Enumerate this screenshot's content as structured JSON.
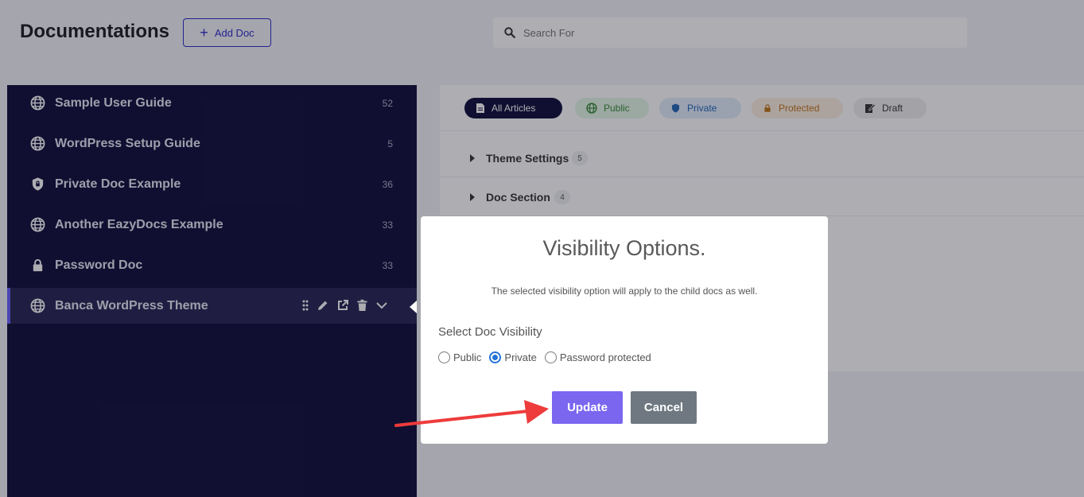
{
  "header": {
    "title": "Documentations",
    "add_doc_label": "Add Doc",
    "search_placeholder": "Search For"
  },
  "sidebar": {
    "items": [
      {
        "label": "Sample User Guide",
        "count": "52",
        "icon": "globe-icon"
      },
      {
        "label": "WordPress Setup Guide",
        "count": "5",
        "icon": "globe-icon"
      },
      {
        "label": "Private Doc Example",
        "count": "36",
        "icon": "shield-icon"
      },
      {
        "label": "Another EazyDocs Example",
        "count": "33",
        "icon": "globe-icon"
      },
      {
        "label": "Password Doc",
        "count": "33",
        "icon": "lock-icon"
      },
      {
        "label": "Banca WordPress Theme",
        "count": "",
        "icon": "globe-icon",
        "active": true
      }
    ]
  },
  "filters": {
    "all": "All Articles",
    "public": "Public",
    "private": "Private",
    "protected": "Protected",
    "draft": "Draft"
  },
  "sections": [
    {
      "label": "Theme Settings",
      "count": "5"
    },
    {
      "label": "Doc Section",
      "count": "4"
    }
  ],
  "modal": {
    "title": "Visibility Options.",
    "description": "The selected visibility option will apply to the child docs as well.",
    "select_label": "Select Doc Visibility",
    "options": [
      "Public",
      "Private",
      "Password protected"
    ],
    "selected": "Private",
    "update_label": "Update",
    "cancel_label": "Cancel"
  },
  "colors": {
    "sidebar_bg": "#0f0d3a",
    "accent": "#7b66f0",
    "annotation_arrow": "#ee3b3b"
  }
}
